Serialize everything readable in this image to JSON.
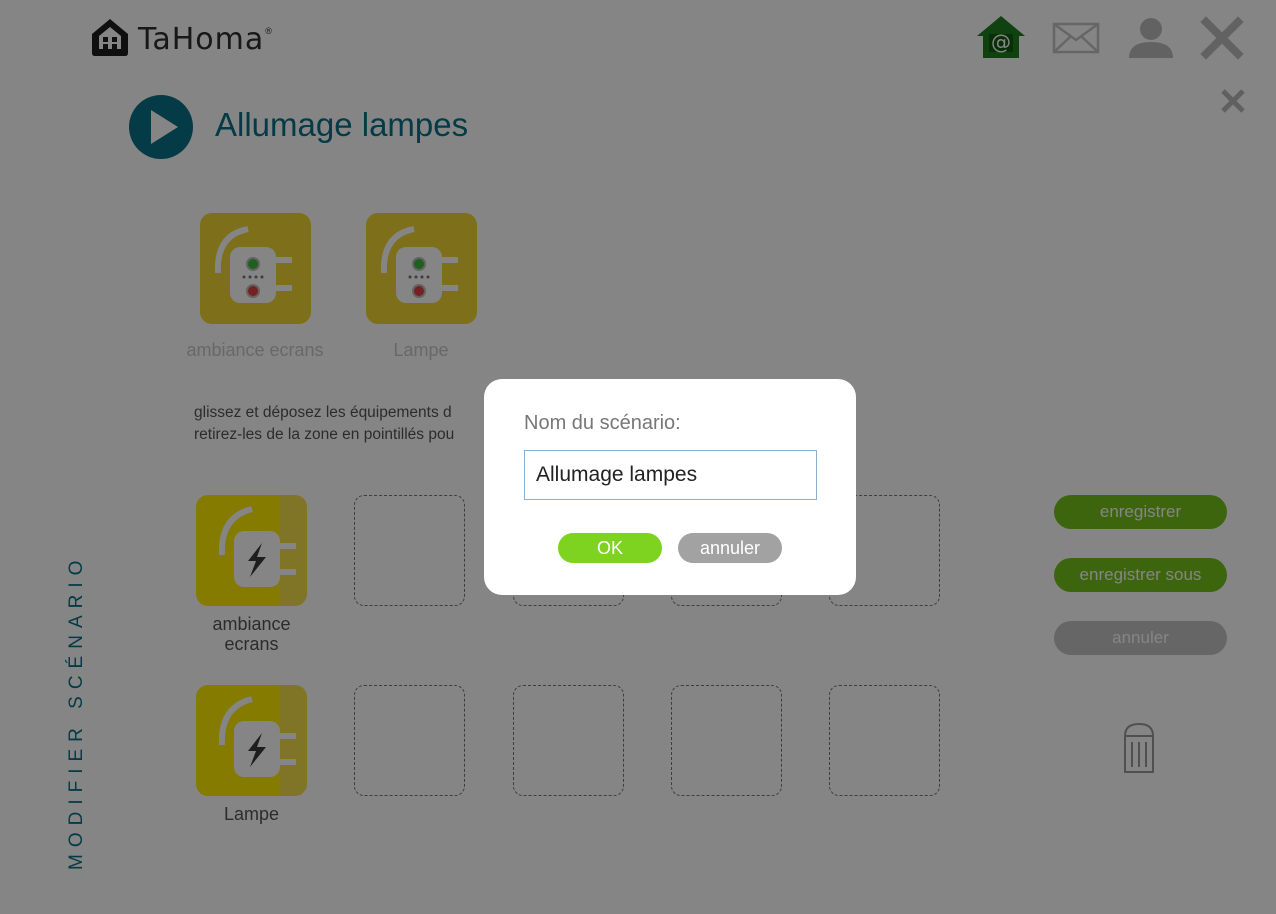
{
  "app": {
    "brand": "TaHoma",
    "reg": "®"
  },
  "colors": {
    "accent": "#0b7188",
    "green": "#74c219",
    "tile_yellow": "#f1d535",
    "tile_yellow_dark": "#dcc400"
  },
  "header_icons": [
    "home-at-icon",
    "mail-icon",
    "user-icon",
    "close-icon"
  ],
  "scenario": {
    "title": "Allumage lampes",
    "side_label": "MODIFIER SCÉNARIO"
  },
  "available_devices": [
    {
      "label": "ambiance ecrans"
    },
    {
      "label": "Lampe"
    }
  ],
  "instructions": {
    "line1": "glissez et déposez les équipements d",
    "line2": "retirez-les de la zone en pointillés pou"
  },
  "placed_devices": [
    {
      "label": "ambiance ecrans"
    },
    {
      "label": "Lampe"
    }
  ],
  "actions": {
    "save": "enregistrer",
    "save_as": "enregistrer sous",
    "cancel": "annuler"
  },
  "dialog": {
    "label": "Nom du scénario:",
    "value": "Allumage lampes",
    "ok": "OK",
    "cancel": "annuler"
  }
}
